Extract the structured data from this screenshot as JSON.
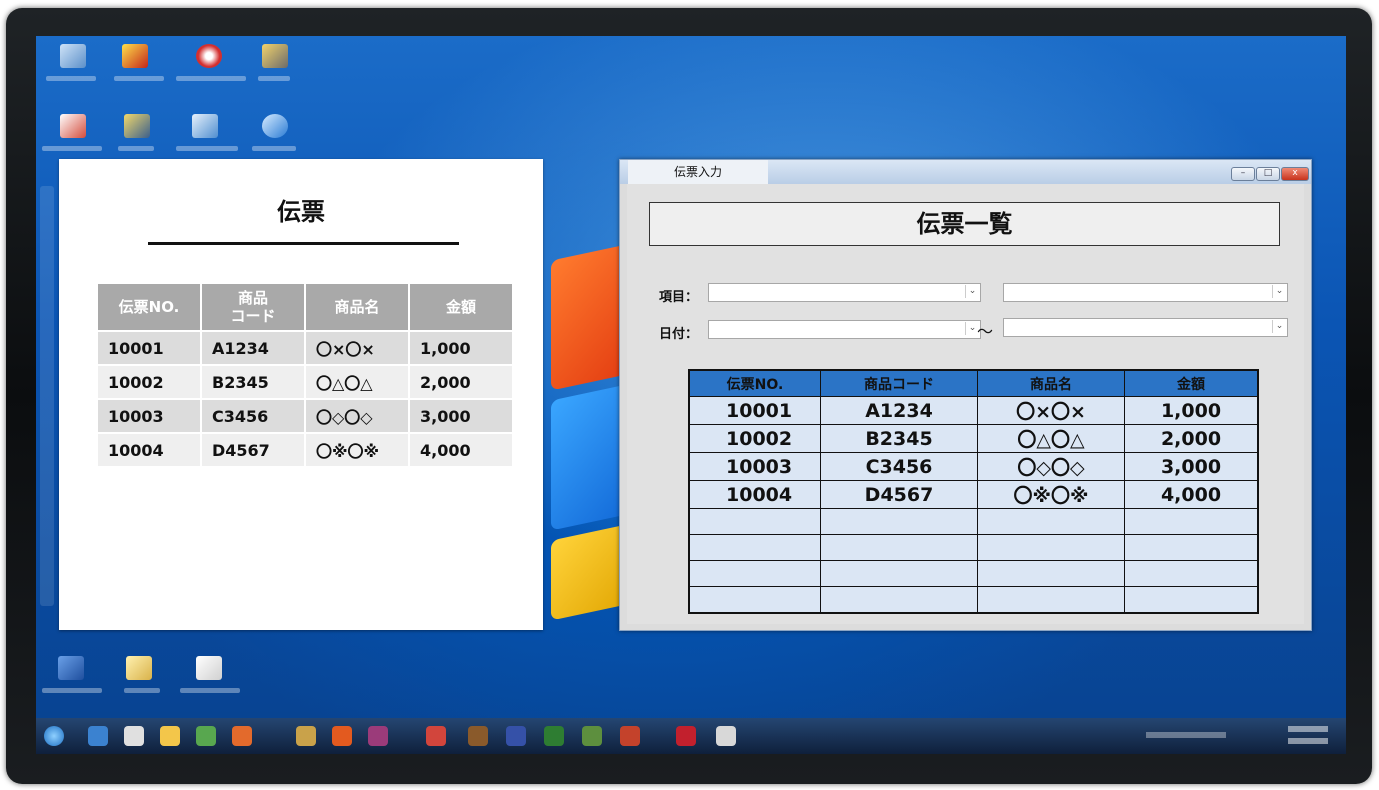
{
  "paper": {
    "title": "伝票",
    "headers": [
      "伝票NO.",
      "商品\nコード",
      "商品名",
      "金額"
    ],
    "rows": [
      [
        "10001",
        "A1234",
        "〇×〇×",
        "1,000"
      ],
      [
        "10002",
        "B2345",
        "〇△〇△",
        "2,000"
      ],
      [
        "10003",
        "C3456",
        "〇◇〇◇",
        "3,000"
      ],
      [
        "10004",
        "D4567",
        "〇※〇※",
        "4,000"
      ]
    ]
  },
  "window": {
    "tab_title": "伝票入力",
    "controls": {
      "minimize": "–",
      "maximize": "□",
      "close": "x"
    },
    "banner": "伝票一覧",
    "filters": {
      "item_label": "項目：",
      "date_label": "日付：",
      "range_sep": "～"
    },
    "grid": {
      "headers": [
        "伝票NO.",
        "商品コード",
        "商品名",
        "金額"
      ],
      "rows": [
        [
          "10001",
          "A1234",
          "〇×〇×",
          "1,000"
        ],
        [
          "10002",
          "B2345",
          "〇△〇△",
          "2,000"
        ],
        [
          "10003",
          "C3456",
          "〇◇〇◇",
          "3,000"
        ],
        [
          "10004",
          "D4567",
          "〇※〇※",
          "4,000"
        ],
        [
          "",
          "",
          "",
          ""
        ],
        [
          "",
          "",
          "",
          ""
        ],
        [
          "",
          "",
          "",
          ""
        ],
        [
          "",
          "",
          "",
          ""
        ]
      ]
    }
  },
  "colors": {
    "grid_header": "#2b74c6",
    "grid_cell": "#dbe6f4",
    "paper_header": "#a9a9a9"
  }
}
